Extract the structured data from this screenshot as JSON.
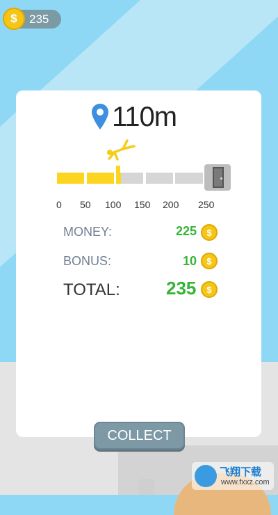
{
  "header": {
    "coins": "235"
  },
  "distance": {
    "value": "110m"
  },
  "progress": {
    "ticks": [
      "0",
      "50",
      "100",
      "150",
      "200",
      "250"
    ],
    "filled_fraction": 0.44,
    "colors": {
      "filled": "#fcd520",
      "empty": "#d6d6d6"
    }
  },
  "rewards": {
    "money_label": "MONEY:",
    "money_value": "225",
    "bonus_label": "BONUS:",
    "bonus_value": "10",
    "total_label": "TOTAL:",
    "total_value": "235"
  },
  "buttons": {
    "collect": "COLLECT"
  },
  "watermark": {
    "title": "飞翔下载",
    "url": "www.fxxz.com"
  },
  "icons": {
    "coin": "coin-icon",
    "pin": "location-pin-icon",
    "door": "door-icon",
    "runner": "jumping-person-icon"
  },
  "colors": {
    "sky": "#8fd8f5",
    "green_value": "#36b436",
    "label_gray": "#6f8092",
    "button": "#7e99a6",
    "coin": "#f5c518"
  }
}
